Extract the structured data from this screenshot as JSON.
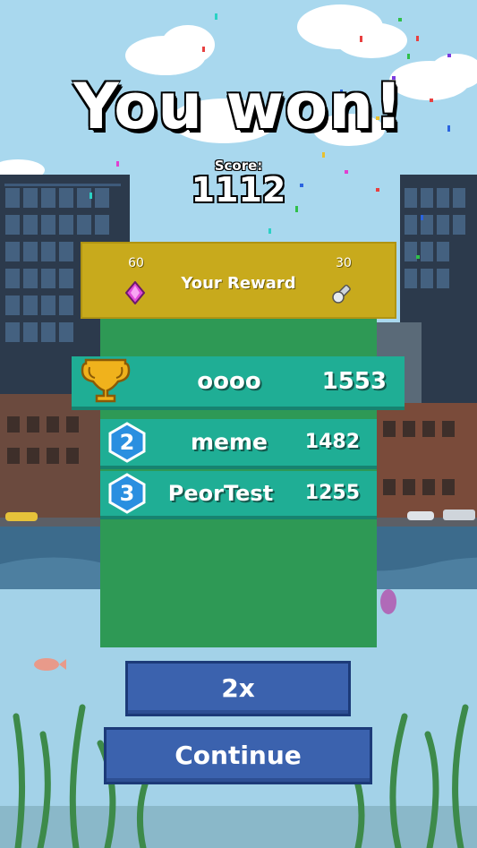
{
  "header": {
    "title": "You won!",
    "score_label": "Score:",
    "score_value": "1112"
  },
  "reward": {
    "gems_count": "60",
    "label": "Your Reward",
    "bolts_count": "30"
  },
  "leaderboard": [
    {
      "rank": "1",
      "rank_icon": "trophy-icon",
      "name": "oooo",
      "score": "1553"
    },
    {
      "rank": "2",
      "rank_icon": "hexagon-badge-icon",
      "name": "meme",
      "score": "1482"
    },
    {
      "rank": "3",
      "rank_icon": "hexagon-badge-icon",
      "name": "PeorTest",
      "score": "1255"
    }
  ],
  "buttons": {
    "double_label": "2x",
    "continue_label": "Continue"
  },
  "colors": {
    "reward_bg": "#c8aa1c",
    "board_bg": "#2e9955",
    "row_bg": "#1fae95",
    "button_bg": "#3b62ae",
    "gem": "#e04ad8",
    "badge": "#2a8fe0"
  }
}
